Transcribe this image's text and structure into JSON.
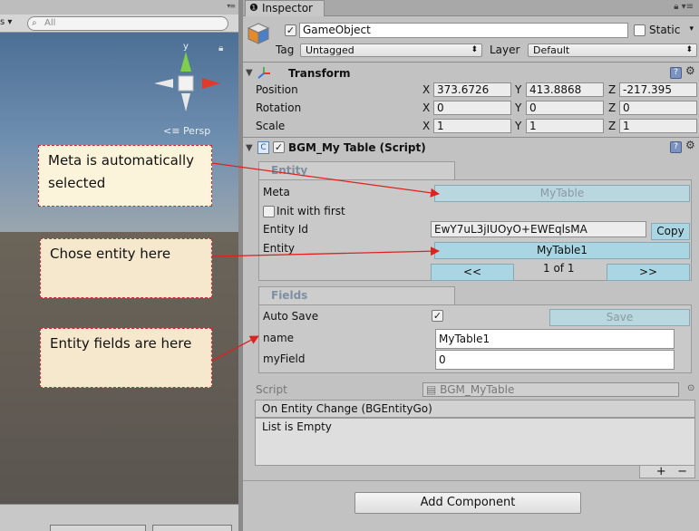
{
  "scene": {
    "toolbar_dropdown": "s ▾",
    "search_placeholder": "All",
    "gizmo_y": "y",
    "persp_label": "Persp"
  },
  "notes": {
    "meta": "Meta is automatically selected",
    "entity": "Chose entity here",
    "fields": "Entity fields are here"
  },
  "inspector": {
    "tab_title": "Inspector",
    "gameobject": {
      "name": "GameObject",
      "static_label": "Static",
      "tag_label": "Tag",
      "tag_value": "Untagged",
      "layer_label": "Layer",
      "layer_value": "Default"
    },
    "transform": {
      "title": "Transform",
      "rows": [
        {
          "label": "Position",
          "x": "373.6726",
          "y": "413.8868",
          "z": "-217.395"
        },
        {
          "label": "Rotation",
          "x": "0",
          "y": "0",
          "z": "0"
        },
        {
          "label": "Scale",
          "x": "1",
          "y": "1",
          "z": "1"
        }
      ],
      "axis_x": "X",
      "axis_y": "Y",
      "axis_z": "Z"
    },
    "script_component": {
      "title": "BGM_My Table (Script)",
      "entity_group": {
        "title": "Entity",
        "meta_label": "Meta",
        "meta_value": "MyTable",
        "init_label": "Init with first",
        "entity_id_label": "Entity Id",
        "entity_id_value": "EwY7uL3jIUOyO+EWEqlsMA",
        "copy_label": "Copy",
        "entity_label": "Entity",
        "entity_value": "MyTable1",
        "prev_label": "<<",
        "page_label": "1 of 1",
        "next_label": ">>"
      },
      "fields_group": {
        "title": "Fields",
        "auto_save_label": "Auto Save",
        "save_label": "Save",
        "fields": [
          {
            "label": "name",
            "value": "MyTable1"
          },
          {
            "label": "myField",
            "value": "0"
          }
        ]
      },
      "script_label": "Script",
      "script_value": "BGM_MyTable",
      "event_title": "On Entity Change (BGEntityGo)",
      "event_empty": "List is Empty",
      "plus": "+",
      "minus": "−"
    },
    "add_component_label": "Add Component"
  },
  "colors": {
    "arrow": "#e0211f",
    "note_border": "#dd2233",
    "toggle_button": "#a9d6e2"
  }
}
